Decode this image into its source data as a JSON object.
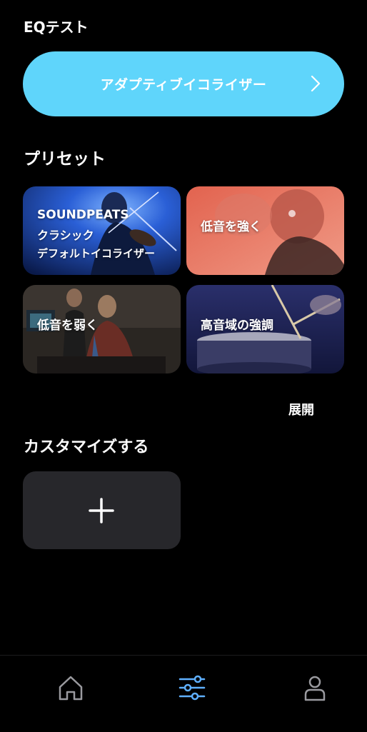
{
  "page": {
    "eq_test_label": "EQテスト",
    "adaptive_eq_label": "アダプティブイコライザー",
    "preset_title": "プリセット",
    "expand_label": "展開",
    "customize_title": "カスタマイズする"
  },
  "presets": [
    {
      "brand": "SOUNDPEATS",
      "line1": "クラシック",
      "line2": "デフォルトイコライザー"
    },
    {
      "label": "低音を強く"
    },
    {
      "label": "低音を弱く"
    },
    {
      "label": "高音域の強調"
    }
  ],
  "colors": {
    "accent": "#5fd5fb",
    "nav_active": "#5fb0ff",
    "nav_inactive": "#9a9a9f",
    "add_button_bg": "#27272b"
  },
  "icons": {
    "adaptive_arrow": "chevron-right-icon",
    "add": "plus-icon",
    "nav_home": "home-icon",
    "nav_eq": "equalizer-icon",
    "nav_user": "user-icon"
  }
}
